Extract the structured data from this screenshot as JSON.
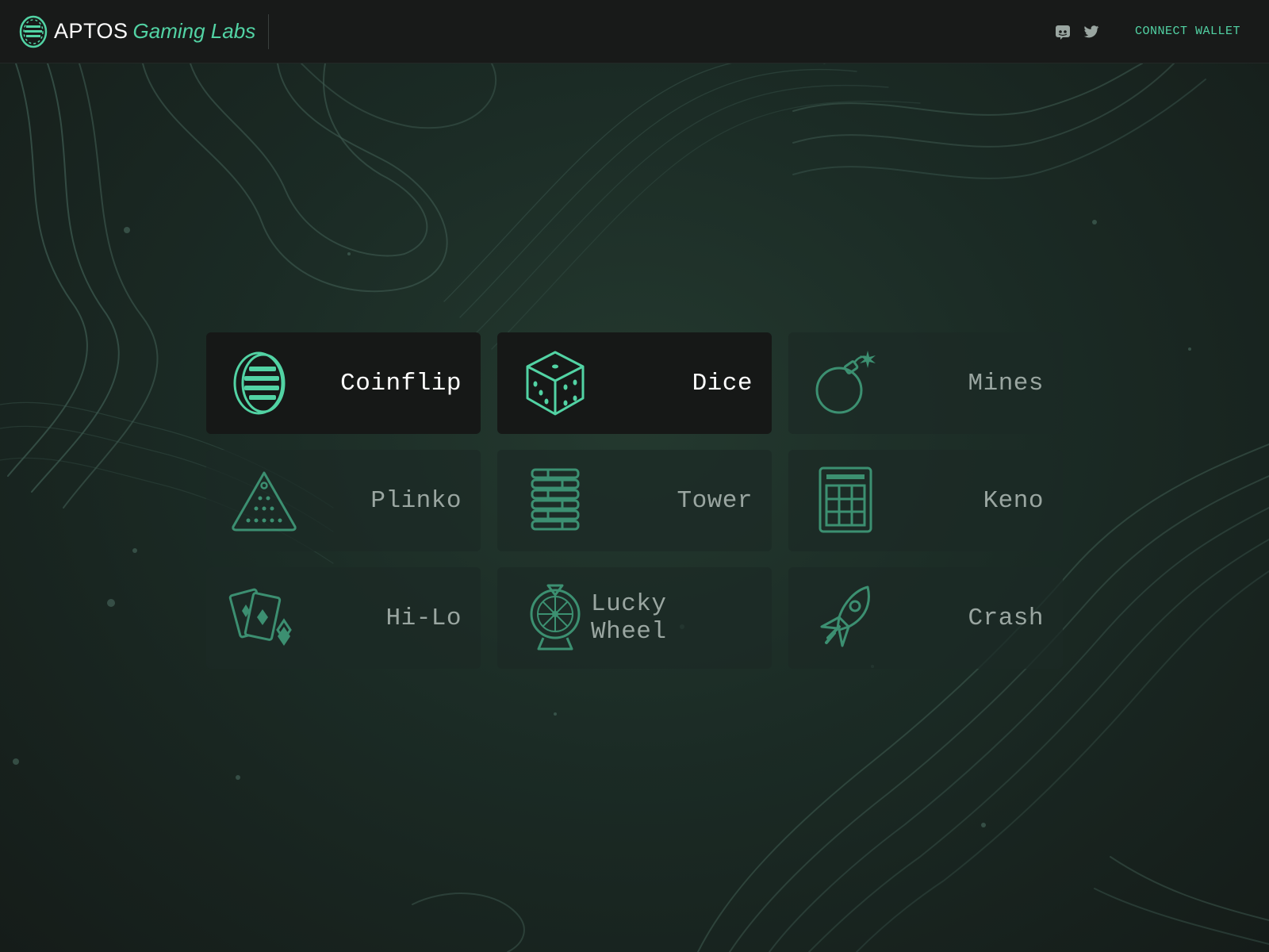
{
  "app": {
    "brand": "APTOS",
    "brand_sub": "Gaming Labs"
  },
  "header": {
    "connect_label": "CONNECT WALLET",
    "socials": [
      "discord-icon",
      "twitter-icon"
    ]
  },
  "colors": {
    "accent": "#52d3a4",
    "header_bg": "#181a19",
    "card_active_bg": "#161817",
    "page_bg": "#1b2b25"
  },
  "games": [
    {
      "label": "Coinflip",
      "icon": "coin-icon",
      "active": true
    },
    {
      "label": "Dice",
      "icon": "dice-icon",
      "active": true
    },
    {
      "label": "Mines",
      "icon": "bomb-icon",
      "active": false
    },
    {
      "label": "Plinko",
      "icon": "plinko-triangle-icon",
      "active": false
    },
    {
      "label": "Tower",
      "icon": "tower-stack-icon",
      "active": false
    },
    {
      "label": "Keno",
      "icon": "keno-grid-icon",
      "active": false
    },
    {
      "label": "Hi-Lo",
      "icon": "playing-cards-icon",
      "active": false
    },
    {
      "label": "Lucky Wheel",
      "icon": "wheel-icon",
      "active": false
    },
    {
      "label": "Crash",
      "icon": "rocket-icon",
      "active": false
    }
  ]
}
